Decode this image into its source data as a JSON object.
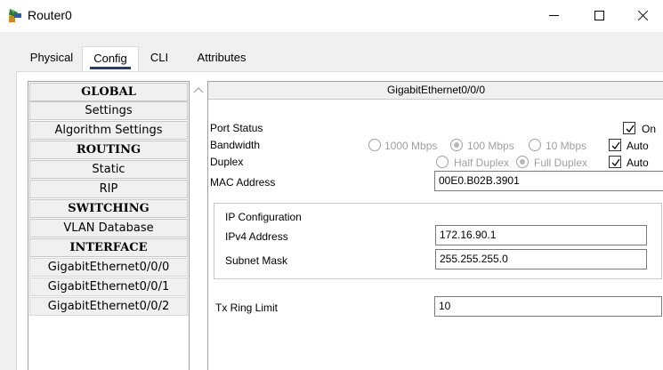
{
  "window": {
    "title": "Router0",
    "minimize_glyph": "—",
    "maximize_glyph": "☐",
    "close_glyph": "✕"
  },
  "tabs": [
    {
      "label": "Physical",
      "active": false
    },
    {
      "label": "Config",
      "active": true
    },
    {
      "label": "CLI",
      "active": false
    },
    {
      "label": "Attributes",
      "active": false
    }
  ],
  "nav": {
    "items": [
      {
        "label": "GLOBAL",
        "type": "heading"
      },
      {
        "label": "Settings",
        "type": "item"
      },
      {
        "label": "Algorithm Settings",
        "type": "item"
      },
      {
        "label": "ROUTING",
        "type": "heading"
      },
      {
        "label": "Static",
        "type": "item"
      },
      {
        "label": "RIP",
        "type": "item"
      },
      {
        "label": "SWITCHING",
        "type": "heading"
      },
      {
        "label": "VLAN Database",
        "type": "item"
      },
      {
        "label": "INTERFACE",
        "type": "heading"
      },
      {
        "label": "GigabitEthernet0/0/0",
        "type": "iface",
        "selected": true
      },
      {
        "label": "GigabitEthernet0/0/1",
        "type": "iface"
      },
      {
        "label": "GigabitEthernet0/0/2",
        "type": "iface"
      }
    ]
  },
  "detail": {
    "header": "GigabitEthernet0/0/0",
    "port_status": {
      "label": "Port Status",
      "on_label": "On",
      "on_checked": true
    },
    "bandwidth": {
      "label": "Bandwidth",
      "options": [
        "1000 Mbps",
        "100 Mbps",
        "10 Mbps"
      ],
      "selected": "100 Mbps",
      "auto_label": "Auto",
      "auto_checked": true
    },
    "duplex": {
      "label": "Duplex",
      "options": [
        "Half Duplex",
        "Full Duplex"
      ],
      "selected": "Full Duplex",
      "auto_label": "Auto",
      "auto_checked": true
    },
    "mac": {
      "label": "MAC Address",
      "value": "00E0.B02B.3901"
    },
    "ip_config": {
      "title": "IP Configuration",
      "ipv4_label": "IPv4 Address",
      "ipv4_value": "172.16.90.1",
      "mask_label": "Subnet Mask",
      "mask_value": "255.255.255.0"
    },
    "tx_ring": {
      "label": "Tx Ring Limit",
      "value": "10"
    }
  }
}
